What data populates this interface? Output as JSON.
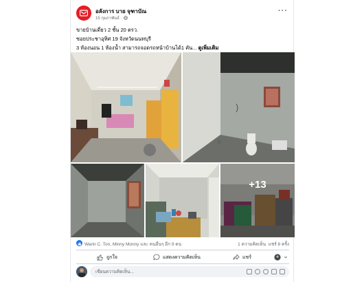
{
  "post": {
    "page_name": "อลังการ บาย จุฑาบัณ",
    "date": "15 กุมภาพันธ์ ·",
    "line1": "ขายบ้านเดี่ยว 2 ชั้น 20 ตรว.",
    "line2": "ซอยประชาอุทิศ 19 จังหวัดนนทบุรี",
    "line3": "3 ห้องนอน 1 ห้องน้ำ สามารถจอดรถหน้าบ้านได้1 คัน... ",
    "see_more": "ดูเพิ่มเติม",
    "more_photos": "+13"
  },
  "reactions": {
    "names": "Warin C. Ton, Minny Monny และ คนอื่นๆ อีก 9 คน",
    "comments": "1 ความคิดเห็น",
    "shares": "แชร์ 8 ครั้ง"
  },
  "actions": {
    "like": "ถูกใจ",
    "comment": "แสดงความคิดเห็น",
    "share": "แชร์"
  },
  "comment_input": {
    "placeholder": "เขียนความคิดเห็น..."
  },
  "colors": {
    "accent": "#1877f2",
    "brand_red": "#e41e26",
    "secondary_text": "#65676b"
  }
}
